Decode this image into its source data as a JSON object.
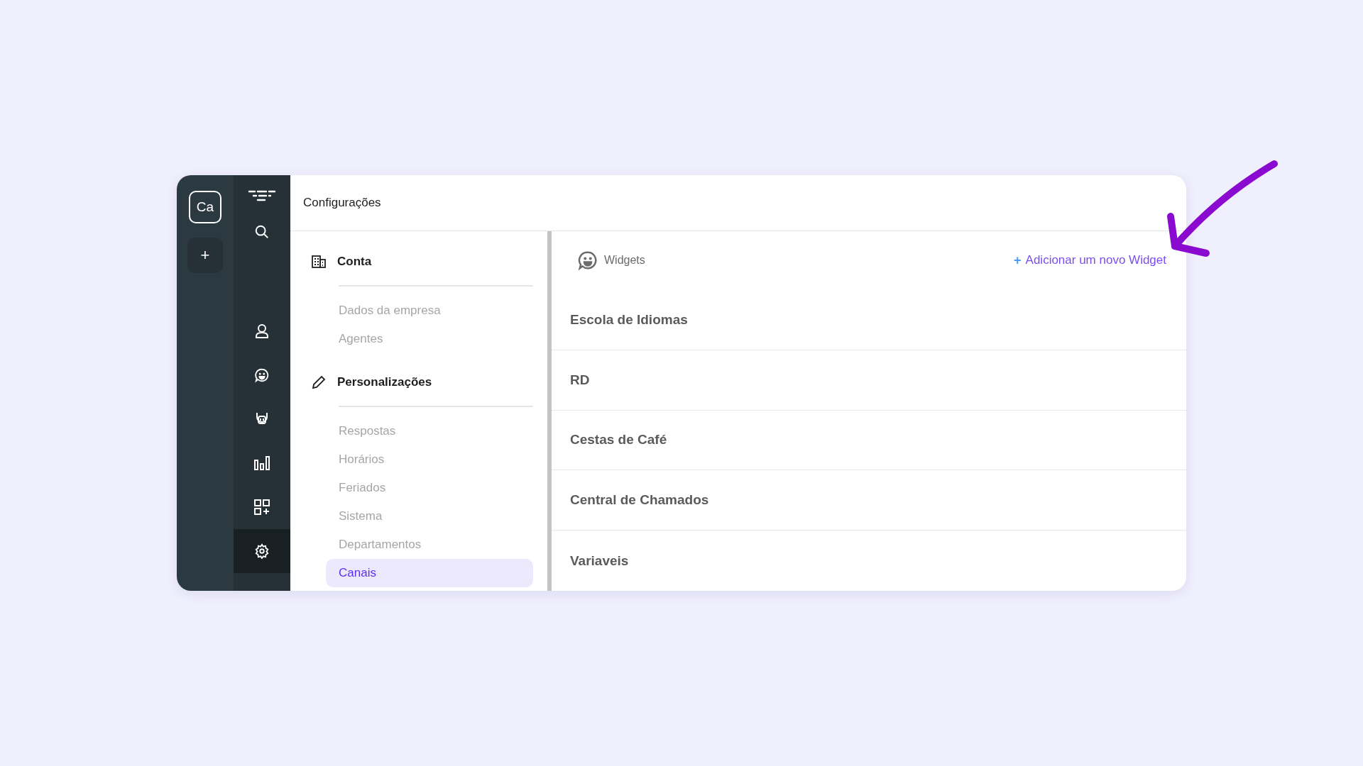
{
  "workspace": {
    "avatar": "Ca",
    "add_button": "+"
  },
  "nav": [
    {
      "kind": "logo",
      "selected": false
    },
    {
      "kind": "search",
      "selected": false
    },
    {
      "kind": "contacts",
      "selected": false
    },
    {
      "kind": "chat",
      "selected": false
    },
    {
      "kind": "bot",
      "selected": false
    },
    {
      "kind": "reports",
      "selected": false
    },
    {
      "kind": "apps",
      "selected": false
    },
    {
      "kind": "settings",
      "selected": true
    }
  ],
  "header": {
    "title": "Configurações"
  },
  "settings_menu": [
    {
      "kind": "building",
      "title": "Conta",
      "items": [
        {
          "label": "Dados da empresa",
          "selected": false
        },
        {
          "label": "Agentes",
          "selected": false
        }
      ]
    },
    {
      "kind": "pencil",
      "title": "Personalizações",
      "items": [
        {
          "label": "Respostas",
          "selected": false
        },
        {
          "label": "Horários",
          "selected": false
        },
        {
          "label": "Feriados",
          "selected": false
        },
        {
          "label": "Sistema",
          "selected": false
        },
        {
          "label": "Departamentos",
          "selected": false
        },
        {
          "label": "Canais",
          "selected": true
        }
      ]
    }
  ],
  "widgets": {
    "title": "Widgets",
    "add_link": {
      "icon": "+",
      "label": "Adicionar um novo Widget"
    },
    "rows": [
      "Escola de Idiomas",
      "RD",
      "Cestas de Café",
      "Central de Chamados",
      "Variaveis"
    ]
  }
}
